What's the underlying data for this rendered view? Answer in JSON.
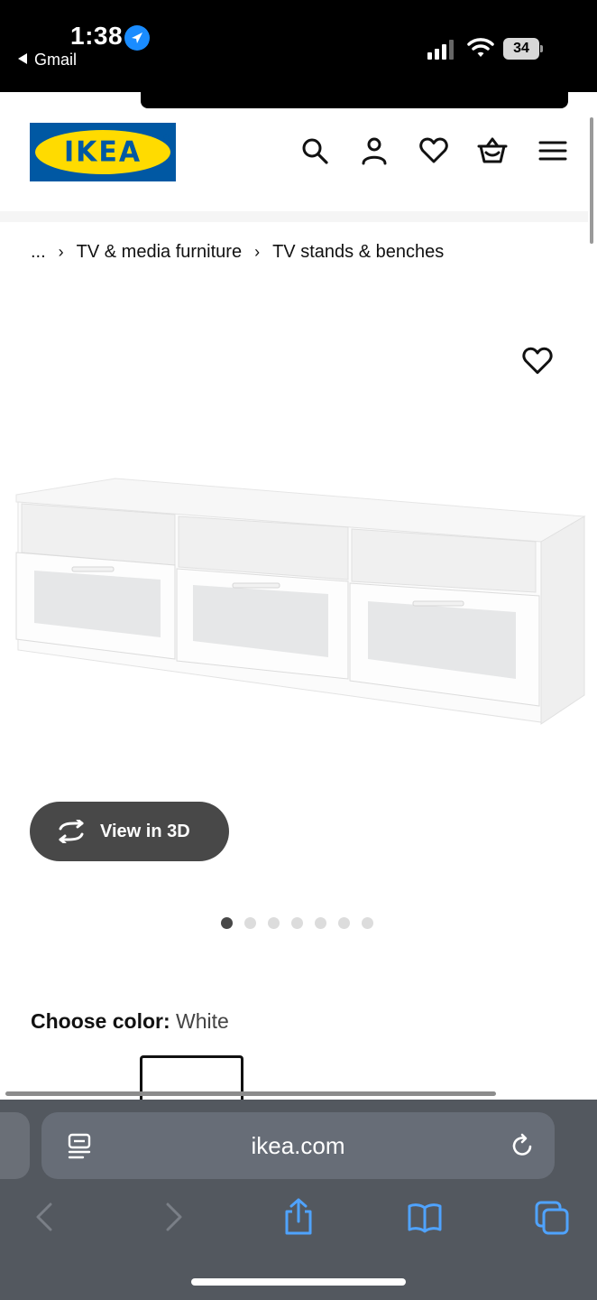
{
  "status_bar": {
    "time": "1:38",
    "back_app": "Gmail",
    "battery": "34"
  },
  "header": {
    "logo_text": "IKEA",
    "logo_mark": "®",
    "icons": [
      "search-icon",
      "profile-icon",
      "heart-icon",
      "basket-icon",
      "menu-icon"
    ]
  },
  "breadcrumb": {
    "ellipsis": "...",
    "items": [
      "TV & media furniture",
      "TV stands & benches"
    ]
  },
  "product": {
    "view_3d_label": "View in 3D",
    "image_count": 7,
    "active_image": 1,
    "choose_color_label": "Choose color:",
    "color_value": "White"
  },
  "browser": {
    "url": "ikea.com"
  },
  "colors": {
    "ikea_blue": "#0058a3",
    "ikea_yellow": "#ffdb00",
    "toolbar": "#53585f",
    "link_blue": "#4fa3ff"
  }
}
